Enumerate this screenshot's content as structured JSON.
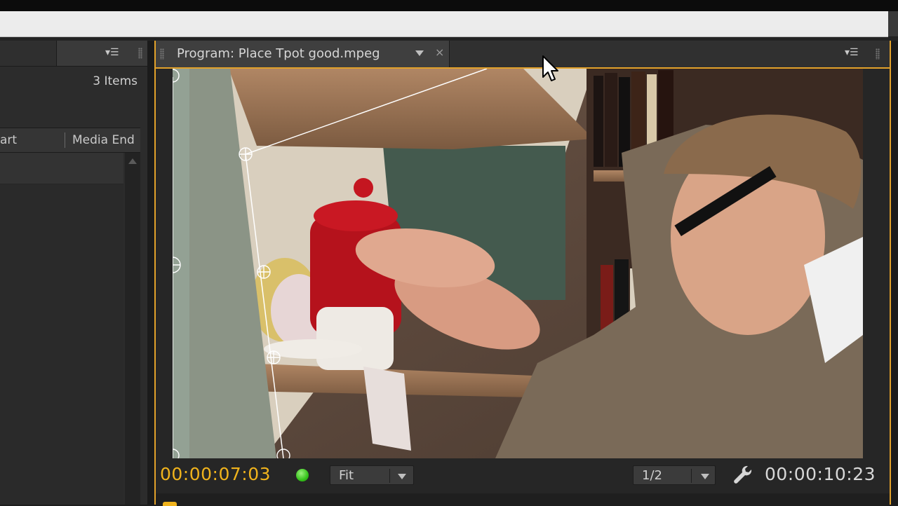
{
  "left_panel": {
    "items_count": "3 Items",
    "columns": [
      "art",
      "Media End"
    ]
  },
  "monitor": {
    "title": "Program: Place Tpot good.mpeg",
    "close_label": "×",
    "timecode_current": "00:00:07:03",
    "zoom": {
      "selected": "Fit"
    },
    "resolution": {
      "selected": "1/2"
    },
    "timecode_duration": "00:00:10:23"
  },
  "colors": {
    "accent": "#e2a12a",
    "timecode": "#f0b31c",
    "playing_indicator": "#35c21a"
  },
  "icons": [
    "panel-menu-icon",
    "dropdown-arrow-icon",
    "close-icon",
    "wrench-icon",
    "mouse-cursor-icon",
    "scroll-up-icon",
    "grip-icon"
  ]
}
